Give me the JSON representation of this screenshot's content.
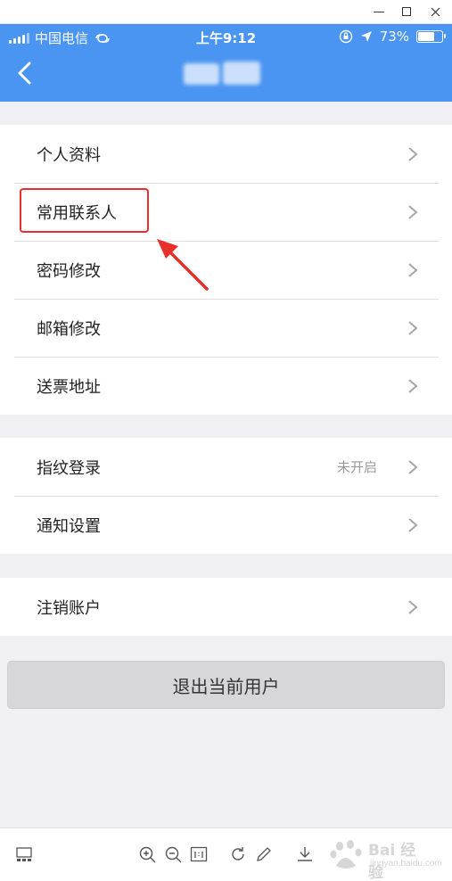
{
  "status_bar": {
    "carrier": "中国电信",
    "time": "上午9:12",
    "battery_text": "73%",
    "battery_level": 0.73
  },
  "menu_group_1": [
    {
      "label": "个人资料"
    },
    {
      "label": "常用联系人"
    },
    {
      "label": "密码修改"
    },
    {
      "label": "邮箱修改"
    },
    {
      "label": "送票地址"
    }
  ],
  "menu_group_2": [
    {
      "label": "指纹登录",
      "value": "未开启"
    },
    {
      "label": "通知设置"
    }
  ],
  "menu_group_3": [
    {
      "label": "注销账户"
    }
  ],
  "logout_label": "退出当前用户",
  "watermark": {
    "main": "Bai 经验",
    "sub": "jingyan.baidu.com"
  },
  "colors": {
    "header": "#4a95f1",
    "highlight": "#e8302a",
    "background": "#efeff4"
  }
}
